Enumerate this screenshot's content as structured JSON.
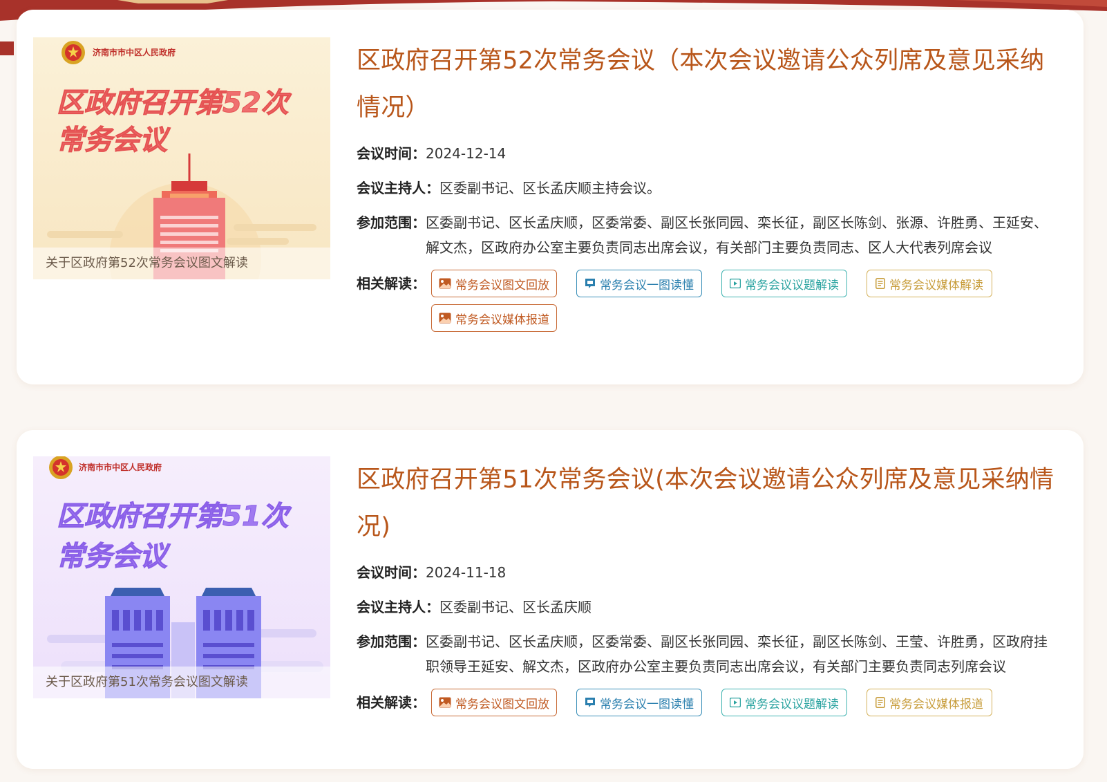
{
  "colors": {
    "title": "#b8561a",
    "btn_orange": "#c86a36",
    "btn_blue": "#3a8fb8",
    "btn_teal": "#3fb3b0",
    "btn_gold": "#d4b15a"
  },
  "labels": {
    "time": "会议时间：",
    "host": "会议主持人：",
    "scope": "参加范围：",
    "related": "相关解读："
  },
  "meetings": [
    {
      "thumb": {
        "org": "济南市市中区人民政府",
        "headline_1": "区政府召开第52次",
        "headline_2": "常务会议",
        "caption": "关于区政府第52次常务会议图文解读"
      },
      "title": "区政府召开第52次常务会议（本次会议邀请公众列席及意见采纳情况）",
      "time": "2024-12-14",
      "host": "区委副书记、区长孟庆顺主持会议。",
      "scope": "区委副书记、区长孟庆顺，区委常委、副区长张同园、栾长征，副区长陈剑、张源、许胜勇、王延安、解文杰，区政府办公室主要负责同志出席会议，有关部门主要负责同志、区人大代表列席会议",
      "buttons": [
        {
          "label": "常务会议图文回放",
          "icon": "image-icon"
        },
        {
          "label": "常务会议一图读懂",
          "icon": "picture-chat-icon"
        },
        {
          "label": "常务会议议题解读",
          "icon": "video-icon"
        },
        {
          "label": "常务会议媒体解读",
          "icon": "document-icon"
        },
        {
          "label": "常务会议媒体报道",
          "icon": "image-icon"
        }
      ]
    },
    {
      "thumb": {
        "org": "济南市市中区人民政府",
        "headline_1": "区政府召开第51次",
        "headline_2": "常务会议",
        "caption": "关于区政府第51次常务会议图文解读"
      },
      "title": "区政府召开第51次常务会议(本次会议邀请公众列席及意见采纳情况)",
      "time": "2024-11-18",
      "host": "区委副书记、区长孟庆顺",
      "scope": "区委副书记、区长孟庆顺，区委常委、副区长张同园、栾长征，副区长陈剑、王莹、许胜勇，区政府挂职领导王延安、解文杰，区政府办公室主要负责同志出席会议，有关部门主要负责同志列席会议",
      "buttons": [
        {
          "label": "常务会议图文回放",
          "icon": "image-icon"
        },
        {
          "label": "常务会议一图读懂",
          "icon": "picture-chat-icon"
        },
        {
          "label": "常务会议议题解读",
          "icon": "video-icon"
        },
        {
          "label": "常务会议媒体报道",
          "icon": "document-icon"
        }
      ]
    }
  ]
}
